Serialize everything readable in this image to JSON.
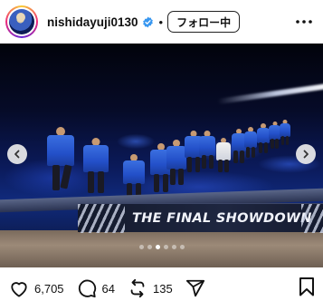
{
  "post": {
    "username": "nishidayuji0130",
    "follow_label": "フォロー中",
    "separator": "•",
    "image": {
      "banner_text": "THE FINAL SHOWDOWN",
      "carousel_dots": 6,
      "active_dot_index": 2
    },
    "stats": {
      "likes": "6,705",
      "comments": "64",
      "reposts": "135"
    }
  },
  "icons": {
    "verified": "verified-badge-icon",
    "more": "more-horizontal-icon",
    "prev": "chevron-left-icon",
    "next": "chevron-right-icon",
    "like": "heart-icon",
    "comment": "comment-icon",
    "repost": "repost-icon",
    "share": "send-icon",
    "save": "bookmark-icon"
  },
  "colors": {
    "verified": "#3897f0",
    "text": "#111111"
  }
}
